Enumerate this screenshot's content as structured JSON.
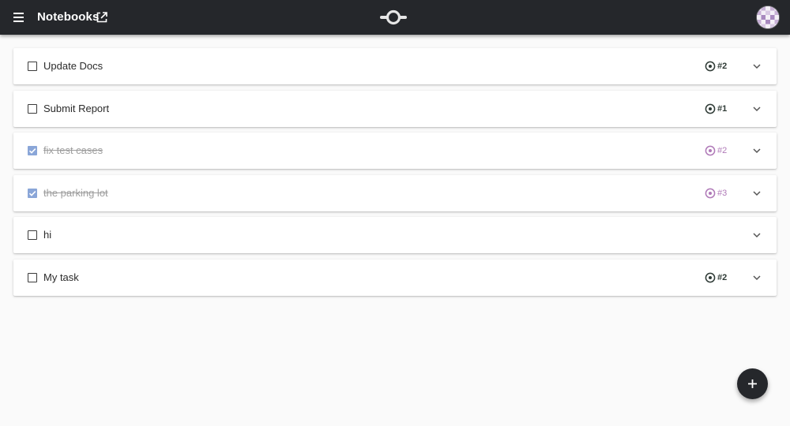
{
  "app_bar": {
    "title": "Notebooks",
    "background": "#25272b"
  },
  "tasks": [
    {
      "label": "Update Docs",
      "done": false,
      "priority": "#2"
    },
    {
      "label": "Submit Report",
      "done": false,
      "priority": "#1"
    },
    {
      "label": "fix test cases",
      "done": true,
      "priority": "#2"
    },
    {
      "label": "the parking lot",
      "done": true,
      "priority": "#3"
    },
    {
      "label": "hi",
      "done": false,
      "priority": ""
    },
    {
      "label": "My task",
      "done": false,
      "priority": "#2"
    }
  ],
  "colors": {
    "priority_active": "#2f3b36",
    "priority_done": "#b07ab8",
    "checkbox_checked": "#8aa6d8",
    "fab": "#25272b"
  },
  "icons": {
    "menu": "menu-icon",
    "open": "open-in-new-icon",
    "logo": "commit-logo-icon",
    "avatar": "avatar",
    "priority": "target-icon",
    "expand": "chevron-down-icon",
    "add": "plus-icon"
  }
}
